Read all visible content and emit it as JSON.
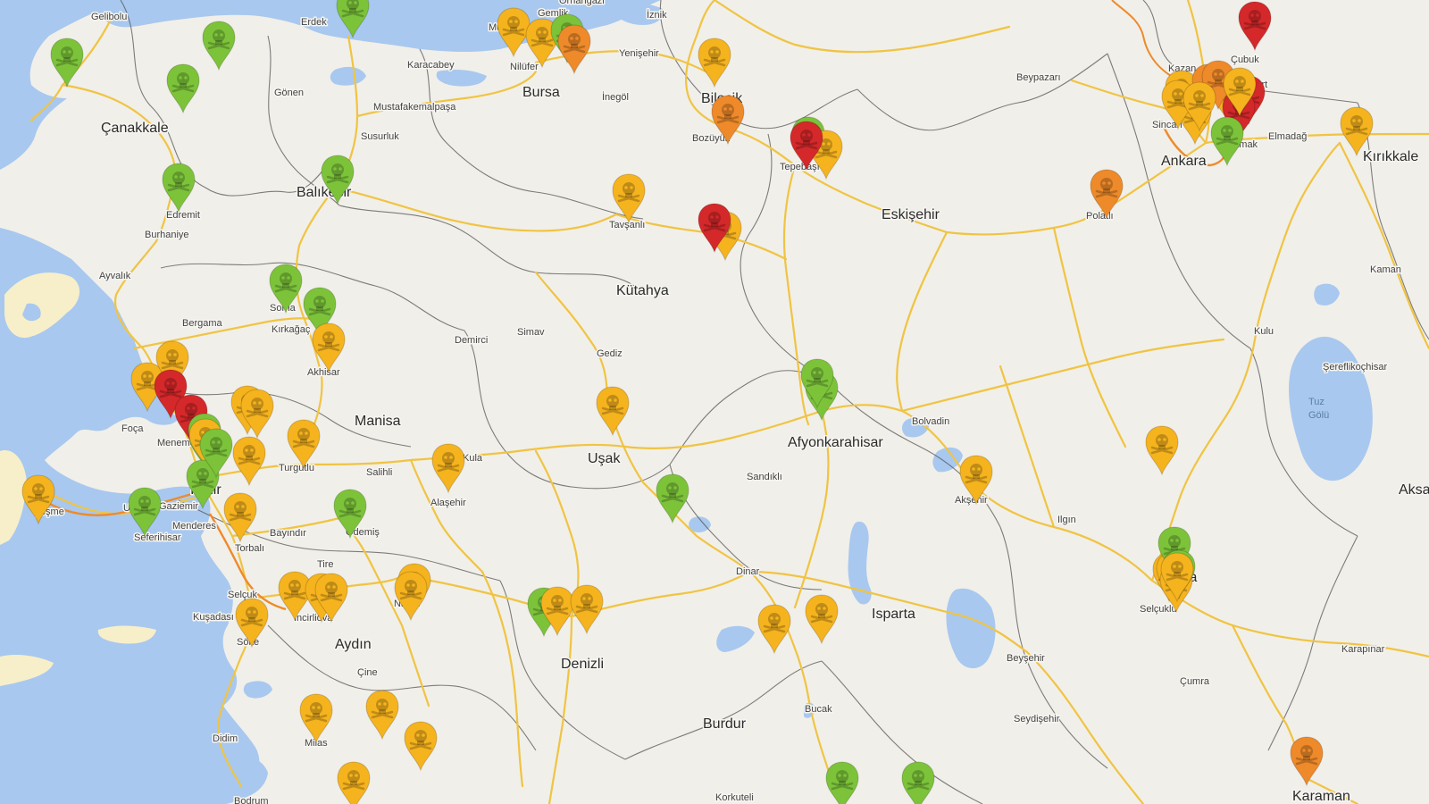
{
  "map": {
    "colors": {
      "land": "#f1efe9",
      "water": "#a8c8ef",
      "road": "#f0c443",
      "border": "#555555",
      "island": "#f7efc9",
      "marker_green": "#7cc33a",
      "marker_yellow": "#f5b31e",
      "marker_orange": "#ee8a2a",
      "marker_red": "#d4282a"
    },
    "labels": [
      {
        "text": "Gelibolu",
        "kind": "town"
      },
      {
        "text": "Erdek",
        "kind": "town"
      },
      {
        "text": "Mudanya",
        "kind": "town"
      },
      {
        "text": "Gemlik",
        "kind": "town"
      },
      {
        "text": "Orhangazi",
        "kind": "town"
      },
      {
        "text": "İznik",
        "kind": "town"
      },
      {
        "text": "Çubuk",
        "kind": "town"
      },
      {
        "text": "Kazan",
        "kind": "town"
      },
      {
        "text": "Akyurt",
        "kind": "town"
      },
      {
        "text": "Karacabey",
        "kind": "town"
      },
      {
        "text": "Nilüfer",
        "kind": "town"
      },
      {
        "text": "Yenişehir",
        "kind": "town"
      },
      {
        "text": "Beypazarı",
        "kind": "town"
      },
      {
        "text": "Bursa",
        "kind": "city"
      },
      {
        "text": "Bilecik",
        "kind": "city"
      },
      {
        "text": "İnegöl",
        "kind": "town"
      },
      {
        "text": "Gönen",
        "kind": "town"
      },
      {
        "text": "Mustafakemalpaşa",
        "kind": "town"
      },
      {
        "text": "Çanakkale",
        "kind": "city"
      },
      {
        "text": "Bozüyük",
        "kind": "town"
      },
      {
        "text": "Sincan",
        "kind": "town"
      },
      {
        "text": "Elmadağ",
        "kind": "town"
      },
      {
        "text": "Mamak",
        "kind": "town"
      },
      {
        "text": "Ankara",
        "kind": "city"
      },
      {
        "text": "Kırıkkale",
        "kind": "city"
      },
      {
        "text": "Susurluk",
        "kind": "town"
      },
      {
        "text": "Tepebaşı",
        "kind": "town"
      },
      {
        "text": "Balıkesir",
        "kind": "city"
      },
      {
        "text": "Edremit",
        "kind": "town"
      },
      {
        "text": "Eskişehir",
        "kind": "city"
      },
      {
        "text": "Tavşanlı",
        "kind": "town"
      },
      {
        "text": "Polatlı",
        "kind": "town"
      },
      {
        "text": "Burhaniye",
        "kind": "town"
      },
      {
        "text": "Ayvalık",
        "kind": "town"
      },
      {
        "text": "Kaman",
        "kind": "town"
      },
      {
        "text": "Kütahya",
        "kind": "city"
      },
      {
        "text": "Soma",
        "kind": "town"
      },
      {
        "text": "Bergama",
        "kind": "town"
      },
      {
        "text": "Kırkağaç",
        "kind": "town"
      },
      {
        "text": "Simav",
        "kind": "town"
      },
      {
        "text": "Kulu",
        "kind": "town"
      },
      {
        "text": "Demirci",
        "kind": "town"
      },
      {
        "text": "Gediz",
        "kind": "town"
      },
      {
        "text": "Akhisar",
        "kind": "town"
      },
      {
        "text": "Şereflikoçhisar",
        "kind": "town"
      },
      {
        "text": "Tuz",
        "kind": "water"
      },
      {
        "text": "Gölü",
        "kind": "water"
      },
      {
        "text": "Foça",
        "kind": "town"
      },
      {
        "text": "Menemen",
        "kind": "town"
      },
      {
        "text": "Manisa",
        "kind": "city"
      },
      {
        "text": "Bolvadin",
        "kind": "town"
      },
      {
        "text": "Afyonkarahisar",
        "kind": "city"
      },
      {
        "text": "Uşak",
        "kind": "city"
      },
      {
        "text": "Turgutlu",
        "kind": "town"
      },
      {
        "text": "Kula",
        "kind": "town"
      },
      {
        "text": "Salihli",
        "kind": "town"
      },
      {
        "text": "Aksaray",
        "kind": "city"
      },
      {
        "text": "Sandıklı",
        "kind": "town"
      },
      {
        "text": "Akşehir",
        "kind": "town"
      },
      {
        "text": "Alaşehir",
        "kind": "town"
      },
      {
        "text": "İzmir",
        "kind": "city"
      },
      {
        "text": "Çeşme",
        "kind": "town"
      },
      {
        "text": "Urla",
        "kind": "town"
      },
      {
        "text": "Gaziemir",
        "kind": "town"
      },
      {
        "text": "Ilgın",
        "kind": "town"
      },
      {
        "text": "Menderes",
        "kind": "town"
      },
      {
        "text": "Seferihisar",
        "kind": "town"
      },
      {
        "text": "Bayındır",
        "kind": "town"
      },
      {
        "text": "Ödemiş",
        "kind": "town"
      },
      {
        "text": "Torbalı",
        "kind": "town"
      },
      {
        "text": "Dinar",
        "kind": "town"
      },
      {
        "text": "Konya",
        "kind": "city"
      },
      {
        "text": "Tire",
        "kind": "town"
      },
      {
        "text": "Isparta",
        "kind": "city"
      },
      {
        "text": "Selçuklu",
        "kind": "town"
      },
      {
        "text": "Selçuk",
        "kind": "town"
      },
      {
        "text": "Nazilli",
        "kind": "town"
      },
      {
        "text": "Kuşadası",
        "kind": "town"
      },
      {
        "text": "İncirliova",
        "kind": "town"
      },
      {
        "text": "Söke",
        "kind": "town"
      },
      {
        "text": "Aydın",
        "kind": "city"
      },
      {
        "text": "Denizli",
        "kind": "city"
      },
      {
        "text": "Beyşehir",
        "kind": "town"
      },
      {
        "text": "Karapınar",
        "kind": "town"
      },
      {
        "text": "Çine",
        "kind": "town"
      },
      {
        "text": "Çumra",
        "kind": "town"
      },
      {
        "text": "Bucak",
        "kind": "town"
      },
      {
        "text": "Burdur",
        "kind": "city"
      },
      {
        "text": "Seydişehir",
        "kind": "town"
      },
      {
        "text": "Didim",
        "kind": "town"
      },
      {
        "text": "Milas",
        "kind": "town"
      },
      {
        "text": "Karaman",
        "kind": "city"
      },
      {
        "text": "Bodrum",
        "kind": "town"
      },
      {
        "text": "Korkuteli",
        "kind": "town"
      }
    ],
    "markers": [
      {
        "status": "green"
      },
      {
        "status": "green"
      },
      {
        "status": "green"
      },
      {
        "status": "green"
      },
      {
        "status": "green"
      },
      {
        "status": "yellow"
      },
      {
        "status": "yellow"
      },
      {
        "status": "green"
      },
      {
        "status": "orange"
      },
      {
        "status": "yellow"
      },
      {
        "status": "red"
      },
      {
        "status": "orange"
      },
      {
        "status": "green"
      },
      {
        "status": "yellow"
      },
      {
        "status": "red"
      },
      {
        "status": "yellow"
      },
      {
        "status": "yellow"
      },
      {
        "status": "yellow"
      },
      {
        "status": "red"
      },
      {
        "status": "orange"
      },
      {
        "status": "yellow"
      },
      {
        "status": "orange"
      },
      {
        "status": "red"
      },
      {
        "status": "yellow"
      },
      {
        "status": "yellow"
      },
      {
        "status": "green"
      },
      {
        "status": "yellow"
      },
      {
        "status": "green"
      },
      {
        "status": "orange"
      },
      {
        "status": "yellow"
      },
      {
        "status": "yellow"
      },
      {
        "status": "red"
      },
      {
        "status": "green"
      },
      {
        "status": "green"
      },
      {
        "status": "yellow"
      },
      {
        "status": "yellow"
      },
      {
        "status": "yellow"
      },
      {
        "status": "red"
      },
      {
        "status": "red"
      },
      {
        "status": "yellow"
      },
      {
        "status": "yellow"
      },
      {
        "status": "green"
      },
      {
        "status": "green"
      },
      {
        "status": "yellow"
      },
      {
        "status": "yellow"
      },
      {
        "status": "green"
      },
      {
        "status": "green"
      },
      {
        "status": "yellow"
      },
      {
        "status": "yellow"
      },
      {
        "status": "yellow"
      },
      {
        "status": "yellow"
      },
      {
        "status": "yellow"
      },
      {
        "status": "green"
      },
      {
        "status": "yellow"
      },
      {
        "status": "yellow"
      },
      {
        "status": "yellow"
      },
      {
        "status": "green"
      },
      {
        "status": "green"
      },
      {
        "status": "yellow"
      },
      {
        "status": "green"
      },
      {
        "status": "yellow"
      },
      {
        "status": "yellow"
      },
      {
        "status": "yellow"
      },
      {
        "status": "yellow"
      },
      {
        "status": "yellow"
      },
      {
        "status": "yellow"
      },
      {
        "status": "green"
      },
      {
        "status": "yellow"
      },
      {
        "status": "yellow"
      },
      {
        "status": "yellow"
      },
      {
        "status": "yellow"
      },
      {
        "status": "green"
      },
      {
        "status": "yellow"
      },
      {
        "status": "yellow"
      },
      {
        "status": "yellow"
      },
      {
        "status": "orange"
      },
      {
        "status": "yellow"
      },
      {
        "status": "green"
      },
      {
        "status": "green"
      },
      {
        "status": "yellow"
      },
      {
        "status": "yellow"
      },
      {
        "status": "green"
      },
      {
        "status": "green"
      }
    ]
  }
}
